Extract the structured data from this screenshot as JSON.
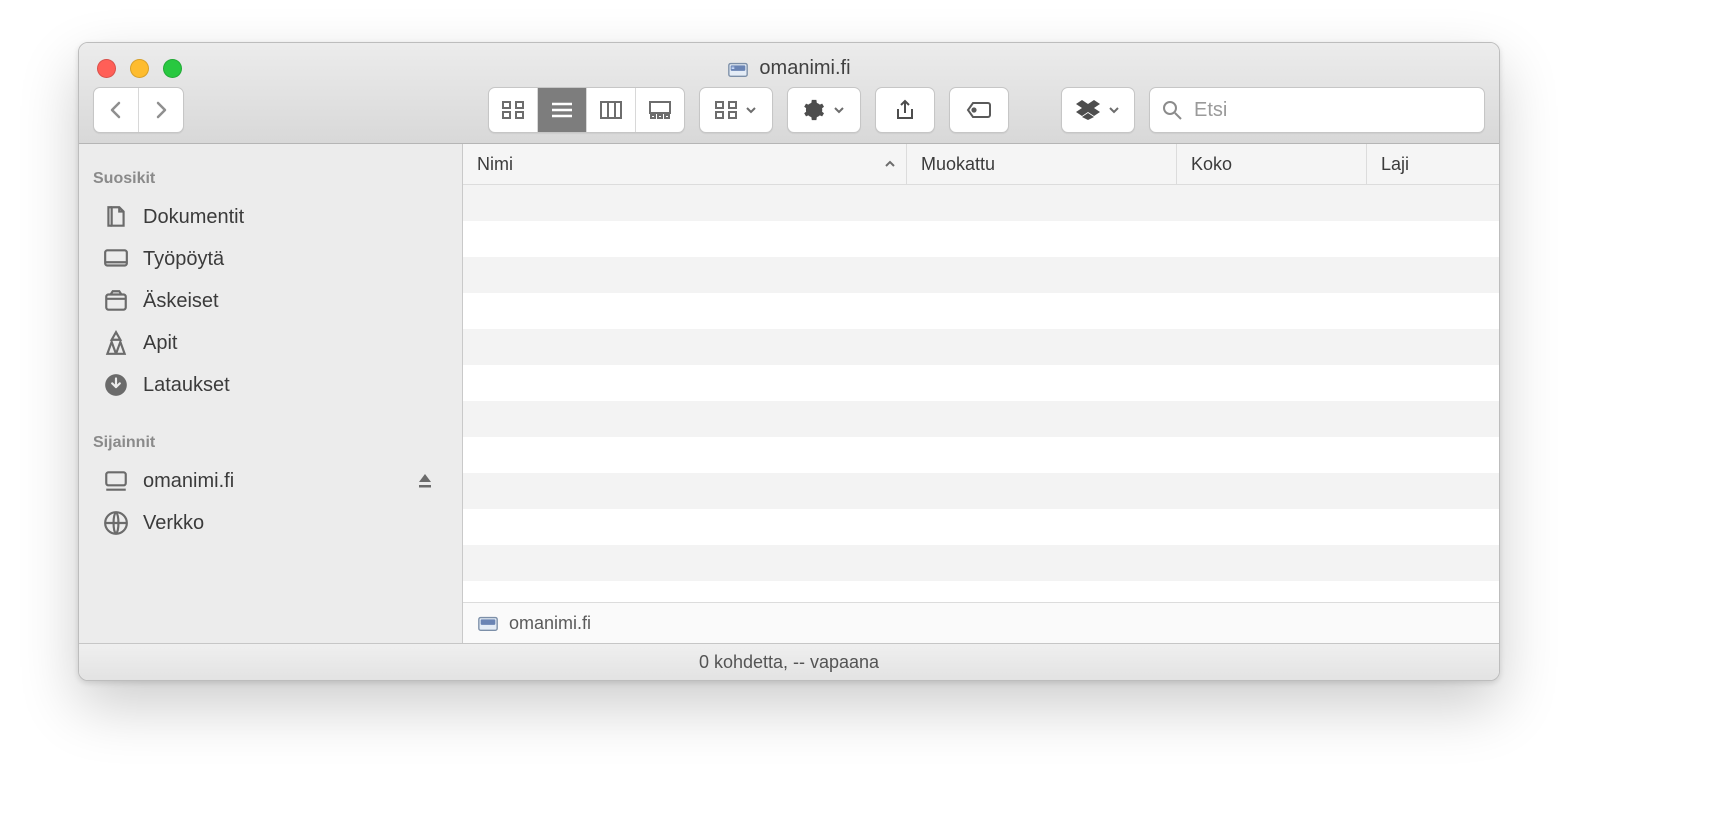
{
  "window": {
    "title": "omanimi.fi"
  },
  "search": {
    "placeholder": "Etsi"
  },
  "sidebar": {
    "sections": [
      {
        "title": "Suosikit",
        "items": [
          {
            "label": "Dokumentit",
            "icon": "documents"
          },
          {
            "label": "Työpöytä",
            "icon": "desktop"
          },
          {
            "label": "Äskeiset",
            "icon": "recents"
          },
          {
            "label": "Apit",
            "icon": "apps"
          },
          {
            "label": "Lataukset",
            "icon": "downloads"
          }
        ]
      },
      {
        "title": "Sijainnit",
        "items": [
          {
            "label": "omanimi.fi",
            "icon": "computer",
            "ejectable": true
          },
          {
            "label": "Verkko",
            "icon": "network"
          }
        ]
      }
    ]
  },
  "columns": {
    "name": "Nimi",
    "modified": "Muokattu",
    "size": "Koko",
    "kind": "Laji"
  },
  "pathbar": {
    "current": "omanimi.fi"
  },
  "status": {
    "text": "0 kohdetta, -- vapaana"
  }
}
